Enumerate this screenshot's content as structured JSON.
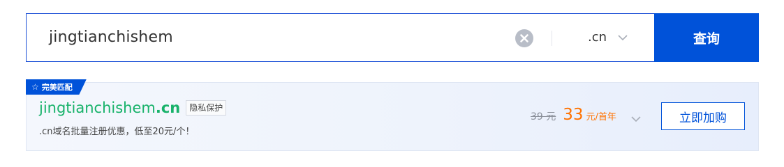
{
  "search": {
    "query": "jingtianchishem",
    "suffix": ".cn",
    "button_label": "查询"
  },
  "result": {
    "tag_label": "完美匹配",
    "domain_base": "jingtianchishem",
    "domain_suffix": ".cn",
    "privacy_label": "隐私保护",
    "promo": ".cn域名批量注册优惠，低至20元/个！",
    "old_price": "39 元",
    "new_price": "33",
    "price_unit": "元/首年",
    "buy_label": "立即加购"
  },
  "colors": {
    "primary": "#0052d9",
    "domain_green": "#17b26a",
    "price_orange": "#ff7200"
  },
  "icons": [
    "clear-icon",
    "chevron-down-icon",
    "star-icon"
  ]
}
